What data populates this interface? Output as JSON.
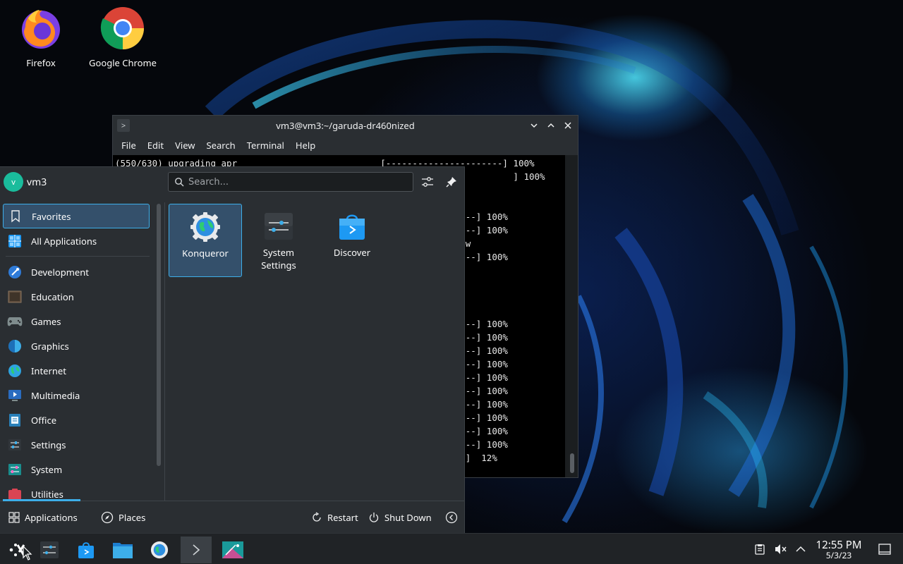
{
  "desktop": {
    "icons": [
      {
        "label": "Firefox",
        "icon": "firefox-icon"
      },
      {
        "label": "Google Chrome",
        "icon": "chrome-icon"
      }
    ]
  },
  "terminal": {
    "title": "vm3@vm3:~/garuda-dr460nized",
    "menu": [
      "File",
      "Edit",
      "View",
      "Search",
      "Terminal",
      "Help"
    ],
    "lines": [
      "(550/630) upgrading apr                           [----------------------] 100%",
      "                                                                           ] 100%",
      "",
      "",
      "                                                   -----------------] 100%",
      "                                                   -----------------] 100%",
      "                                                   irrorlist.pacnew",
      "                                                   -----------------] 100%",
      "",
      "",
      "",
      "",
      "                                                   -----------------] 100%",
      "                                                   -----------------] 100%",
      "                                                   -----------------] 100%",
      "                                                   -----------------] 100%",
      "                                                   -----------------] 100%",
      "                                                   -----------------] 100%",
      "                                                   -----------------] 100%",
      "                                                   -----------------] 100%",
      "                                                   -----------------] 100%",
      "                                                   -----------------] 100%",
      "                                                   o  o  o  o  o  ]  12%"
    ]
  },
  "launcher": {
    "user": {
      "name": "vm3",
      "initial": "v"
    },
    "search": {
      "placeholder": "Search..."
    },
    "categories": [
      {
        "label": "Favorites",
        "icon": "bookmark-icon",
        "active": true
      },
      {
        "label": "All Applications",
        "icon": "grid-apps-icon"
      },
      {
        "label": "Development",
        "icon": "development-icon"
      },
      {
        "label": "Education",
        "icon": "education-icon"
      },
      {
        "label": "Games",
        "icon": "gamepad-icon"
      },
      {
        "label": "Graphics",
        "icon": "graphics-icon"
      },
      {
        "label": "Internet",
        "icon": "globe-icon"
      },
      {
        "label": "Multimedia",
        "icon": "multimedia-icon"
      },
      {
        "label": "Office",
        "icon": "office-icon"
      },
      {
        "label": "Settings",
        "icon": "settings-sliders-icon"
      },
      {
        "label": "System",
        "icon": "system-icon"
      },
      {
        "label": "Utilities",
        "icon": "utilities-icon"
      }
    ],
    "favorites": [
      {
        "label": "Konqueror",
        "icon": "konqueror-icon",
        "selected": true
      },
      {
        "label": "System Settings",
        "line1": "System",
        "line2": "Settings",
        "icon": "system-settings-icon"
      },
      {
        "label": "Discover",
        "icon": "discover-icon"
      }
    ],
    "footer": {
      "applications": "Applications",
      "places": "Places",
      "restart": "Restart",
      "shutdown": "Shut Down"
    }
  },
  "taskbar": {
    "clock": {
      "time": "12:55 PM",
      "date": "5/3/23"
    },
    "items": [
      "application-launcher",
      "system-settings",
      "discover",
      "file-manager",
      "konqueror",
      "terminal",
      "gallery"
    ]
  },
  "colors": {
    "accent": "#3daee9",
    "panel": "#2a2e32",
    "taskbar": "#202326"
  }
}
